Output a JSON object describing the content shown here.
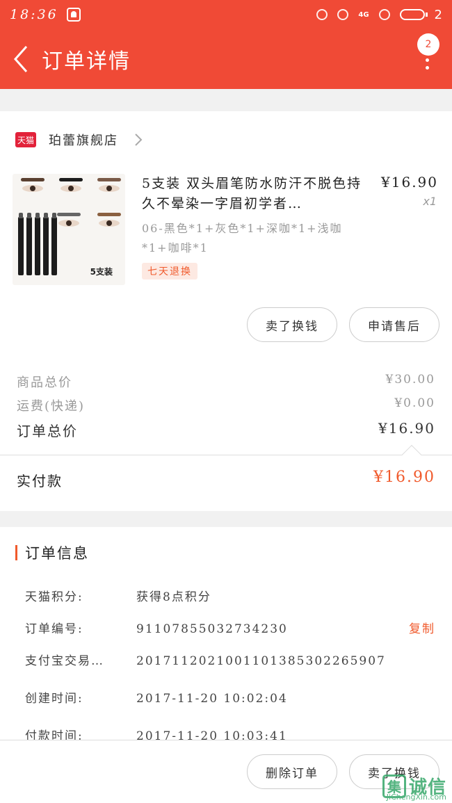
{
  "status_bar": {
    "time": "18:36",
    "network": "4G",
    "battery_level": "2"
  },
  "header": {
    "title": "订单详情",
    "badge_count": "2"
  },
  "store": {
    "platform_badge": "天猫",
    "name": "珀蕾旗舰店"
  },
  "product": {
    "image_caption": "5支装",
    "title": "5支装 双头眉笔防水防汗不脱色持久不晕染一字眉初学者…",
    "price": "¥16.90",
    "quantity": "x1",
    "sku": "06-黑色*1+灰色*1+深咖*1+浅咖*1+咖啡*1",
    "tag": "七天退换",
    "actions": {
      "sell": "卖了换钱",
      "after_sale": "申请售后"
    }
  },
  "fees": [
    {
      "label": "商品总价",
      "value": "¥30.00"
    },
    {
      "label": "运费(快递)",
      "value": "¥0.00"
    },
    {
      "label": "订单总价",
      "value": "¥16.90"
    }
  ],
  "payment": {
    "label": "实付款",
    "value": "¥16.90"
  },
  "order_info": {
    "title": "订单信息",
    "rows": [
      {
        "key": "天猫积分:",
        "value": "获得8点积分"
      },
      {
        "key": "订单编号:",
        "value": "91107855032734230",
        "action": "复制"
      },
      {
        "key": "支付宝交易…",
        "value": "2017112021001101385302265907"
      },
      {
        "key": "创建时间:",
        "value": "2017-11-20  10:02:04"
      },
      {
        "key": "付款时间:",
        "value": "2017-11-20  10:03:41"
      }
    ]
  },
  "bottom_bar": {
    "delete": "删除订单",
    "sell": "卖了换钱"
  },
  "watermark": {
    "logo_char": "集",
    "text": "诚信",
    "site": "JiChengXin.com"
  },
  "colors": {
    "brand": "#f04a36",
    "accent": "#f05a2c",
    "tmall": "#e2223a",
    "watermark": "#37a86a"
  }
}
